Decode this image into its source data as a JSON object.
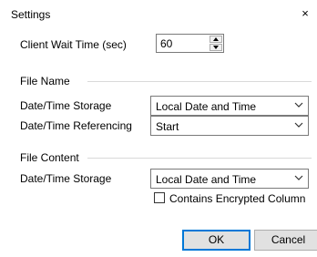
{
  "window": {
    "title": "Settings",
    "close_glyph": "×",
    "close_icon": "close-icon"
  },
  "client_wait": {
    "label": "Client Wait Time (sec)",
    "value": "60"
  },
  "file_name": {
    "group_label": "File Name",
    "datetime_storage": {
      "label": "Date/Time Storage",
      "value": "Local Date and Time"
    },
    "datetime_referencing": {
      "label": "Date/Time Referencing",
      "value": "Start"
    }
  },
  "file_content": {
    "group_label": "File Content",
    "datetime_storage": {
      "label": "Date/Time Storage",
      "value": "Local Date and Time"
    },
    "encrypted_column": {
      "label": "Contains Encrypted Column",
      "checked": false
    }
  },
  "buttons": {
    "ok": "OK",
    "cancel": "Cancel"
  },
  "colors": {
    "default_button_border": "#0078d7",
    "field_border": "#7a7a7a",
    "button_face": "#e1e1e1"
  }
}
